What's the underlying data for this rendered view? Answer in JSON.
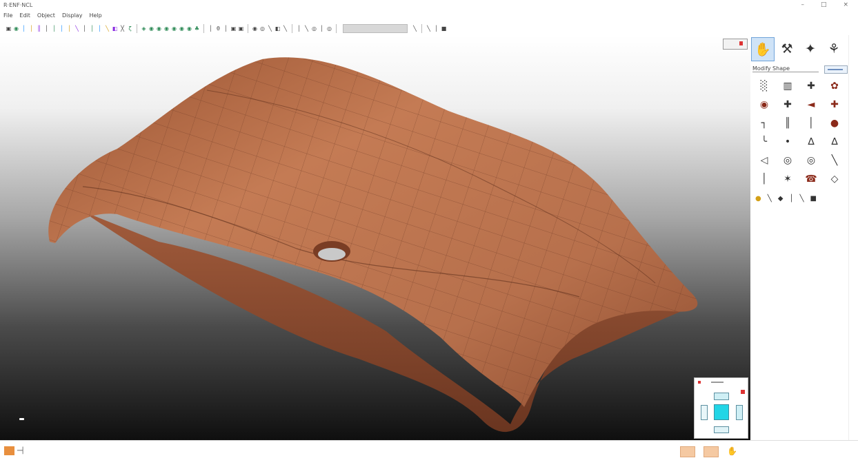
{
  "app": {
    "title": "R·ENF·NCL"
  },
  "window": {
    "minimize": "–",
    "maximize": "□",
    "close": "×"
  },
  "menu": [
    "File",
    "Edit",
    "Object",
    "Display",
    "Help"
  ],
  "toolbar": {
    "groups": [
      [
        "▣",
        "◉",
        "│",
        "│",
        "║",
        "│",
        "│",
        "│",
        "│",
        "╲",
        "│",
        "│",
        "│",
        "╲",
        "◧",
        "╳",
        "ζ"
      ],
      [
        "◈",
        "◉",
        "◉",
        "◉",
        "◉",
        "◉",
        "◉",
        "♣"
      ],
      [
        "│",
        "θ",
        "│",
        "▣",
        "▣"
      ],
      [
        "◉",
        "◎",
        "╲",
        "◧",
        "╲"
      ],
      [
        "│",
        "╲",
        "◎",
        "│",
        "◎"
      ],
      [
        "╲"
      ],
      [
        "╲",
        "│",
        "■"
      ]
    ]
  },
  "panel": {
    "tabs": [
      {
        "icon": "✋",
        "name": "tab-hand"
      },
      {
        "icon": "⚒",
        "name": "tab-tools"
      },
      {
        "icon": "✦",
        "name": "tab-shapes"
      },
      {
        "icon": "⚘",
        "name": "tab-plant"
      }
    ],
    "section_label": "Modify Shape",
    "tools": [
      "░",
      "▥",
      "✚",
      "✿",
      "◉",
      "✚",
      "◄",
      "✚",
      "┐",
      "║",
      "│",
      "●",
      "╰",
      "•",
      "∆",
      "∆",
      "◁",
      "◎",
      "◎",
      "╲",
      "│",
      "✶",
      "☎",
      "◇"
    ],
    "strip": [
      "●",
      "╲",
      "◆",
      "│",
      "╲",
      "■"
    ]
  },
  "status": {
    "left_label": "─┤"
  },
  "colors": {
    "model": "#b66a46",
    "viewport_top": "#ffffff",
    "viewport_bottom": "#0f0f0f",
    "active_tab": "#cfe3f7",
    "cube_front": "#22d5e6"
  }
}
